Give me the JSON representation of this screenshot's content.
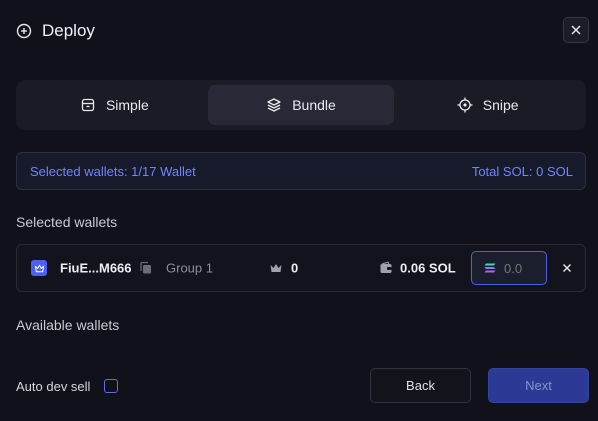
{
  "header": {
    "title": "Deploy"
  },
  "tabs": [
    {
      "label": "Simple",
      "icon": "box-icon",
      "active": false
    },
    {
      "label": "Bundle",
      "icon": "layers-icon",
      "active": true
    },
    {
      "label": "Snipe",
      "icon": "crosshair-icon",
      "active": false
    }
  ],
  "info_bar": {
    "selected": "Selected wallets: 1/17 Wallet",
    "total": "Total SOL: 0 SOL"
  },
  "selected_section": {
    "title": "Selected wallets"
  },
  "wallet": {
    "name": "FiuE...M666",
    "group": "Group 1",
    "count": "0",
    "balance": "0.06 SOL",
    "amount_placeholder": "0.0"
  },
  "available_section": {
    "title": "Available wallets"
  },
  "footer": {
    "auto_dev_sell": "Auto dev sell",
    "back": "Back",
    "next": "Next"
  },
  "colors": {
    "background": "#10111a",
    "accent": "#4d5fe0",
    "info_text": "#6f86ff"
  }
}
